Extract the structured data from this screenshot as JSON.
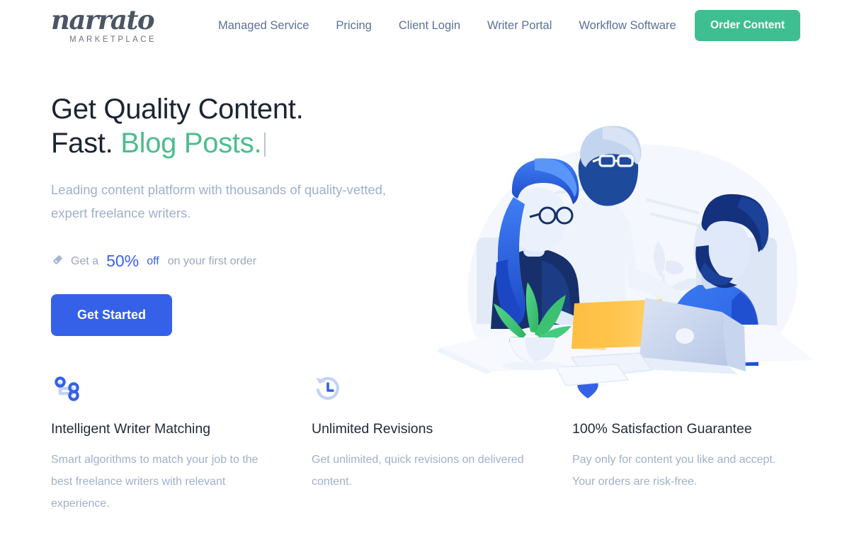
{
  "brand": {
    "logo_word": "narrato",
    "logo_sub": "MARKETPLACE",
    "green": "#3fbf91",
    "blue": "#3461e8",
    "nav_color": "#5c7099"
  },
  "nav": {
    "items": [
      {
        "label": "Managed Service"
      },
      {
        "label": "Pricing"
      },
      {
        "label": "Client Login"
      },
      {
        "label": "Writer Portal"
      },
      {
        "label": "Workflow Software"
      }
    ],
    "cta_label": "Order Content"
  },
  "hero": {
    "headline_line1": "Get Quality Content.",
    "headline_line2_static": "Fast. ",
    "headline_line2_accent": "Blog Posts.",
    "subhead": "Leading content platform with thousands of quality-vetted, expert freelance writers.",
    "promo": {
      "icon": "tag-icon",
      "prefix": "Get a ",
      "percent": "50%",
      "off": "off",
      "suffix": "on your first order"
    },
    "cta_label": "Get Started",
    "illustration": "team-collaboration-illustration"
  },
  "features": [
    {
      "icon": "branch-nodes-icon",
      "title": "Intelligent Writer Matching",
      "desc": "Smart algorithms to match your job to the best freelance writers with relevant experience."
    },
    {
      "icon": "clock-rotate-left-icon",
      "title": "Unlimited Revisions",
      "desc": "Get unlimited, quick revisions on delivered content."
    },
    {
      "icon": "heart-icon",
      "title": "100% Satisfaction Guarantee",
      "desc": "Pay only for content you like and accept. Your orders are risk-free."
    }
  ]
}
